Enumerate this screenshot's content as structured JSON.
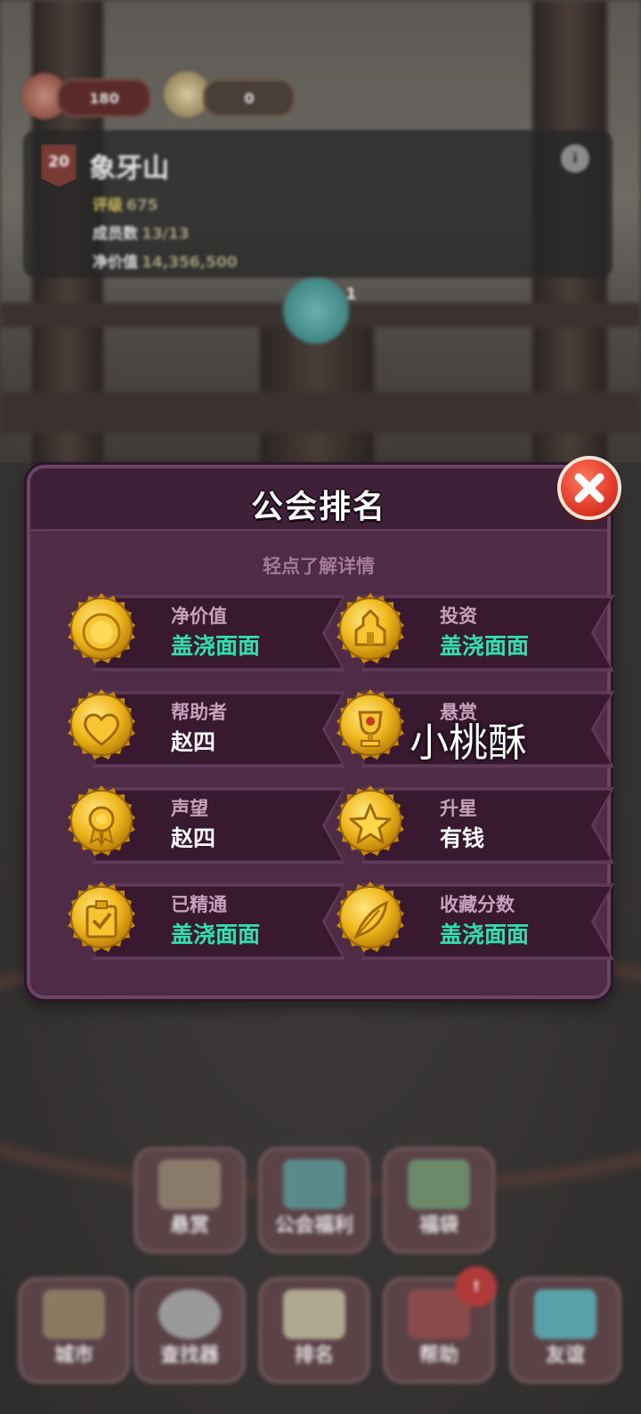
{
  "top_bar": {
    "resource1_value": "180",
    "resource2_value": "0"
  },
  "guild": {
    "level": "20",
    "name": "象牙山",
    "stats": [
      {
        "label": "评级",
        "value": "675"
      },
      {
        "label": "成员数",
        "value": "13/13"
      },
      {
        "label": "净价值",
        "value": "14,356,500"
      }
    ],
    "orb_count": "1"
  },
  "modal": {
    "title": "公会排名",
    "subtitle": "轻点了解详情",
    "close_icon": "close-x-icon",
    "cards": [
      {
        "label": "净价值",
        "value": "盖浇面面",
        "icon": "coin-icon",
        "value_color": "#2fe0b0"
      },
      {
        "label": "投资",
        "value": "盖浇面面",
        "icon": "buildings-icon",
        "value_color": "#2fe0b0"
      },
      {
        "label": "帮助者",
        "value": "赵四",
        "icon": "heart-icon",
        "value_color": "#ffffff"
      },
      {
        "label": "悬赏",
        "value": "",
        "icon": "trophy-icon",
        "value_color": "#ffffff"
      },
      {
        "label": "声望",
        "value": "赵四",
        "icon": "ribbon-medal-icon",
        "value_color": "#ffffff"
      },
      {
        "label": "升星",
        "value": "有钱",
        "icon": "star-icon",
        "value_color": "#ffffff"
      },
      {
        "label": "已精通",
        "value": "盖浇面面",
        "icon": "checkbox-icon",
        "value_color": "#2fe0b0"
      },
      {
        "label": "收藏分数",
        "value": "盖浇面面",
        "icon": "feather-icon",
        "value_color": "#2fe0b0"
      }
    ],
    "overlay_text": "小桃酥"
  },
  "bottom_nav": {
    "row1": [
      "悬赏",
      "公会福利",
      "福袋"
    ],
    "row2": [
      "城市",
      "查找器",
      "排名",
      "帮助",
      "友谊"
    ],
    "help_badge": "!"
  },
  "colors": {
    "modal_bg": "#4f2c46",
    "gold": "#f0b81e",
    "teal_value": "#2fe0b0",
    "close_red": "#e03a2a"
  }
}
